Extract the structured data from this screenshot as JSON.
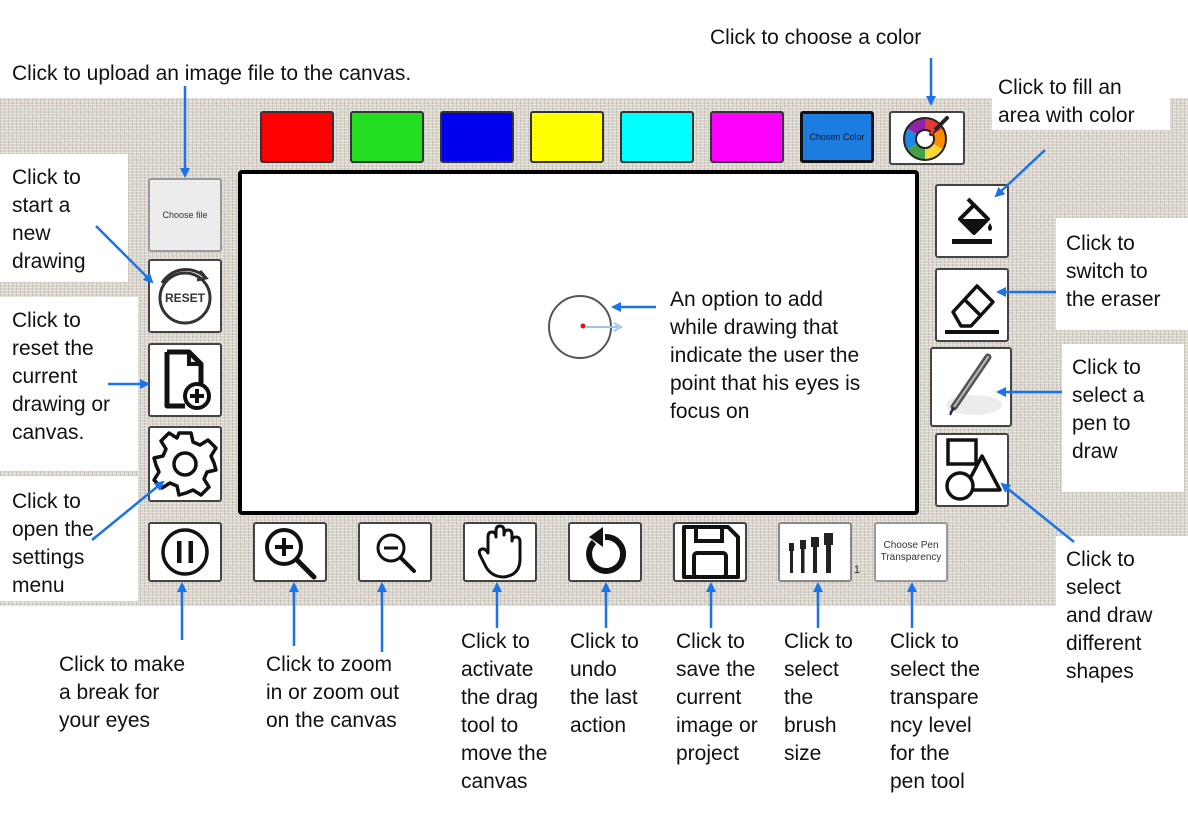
{
  "toolbar": {
    "swatch_colors": [
      "#ff0000",
      "#22dd22",
      "#0000ee",
      "#ffff00",
      "#00ffff",
      "#ff00ff"
    ],
    "chosen_color_label": "Chosen Color",
    "chosen_color_value": "#1c7ce0",
    "palette_icon": "color-palette-icon"
  },
  "left_tools": {
    "choose_file_label": "Choose file",
    "reset_label": "RESET"
  },
  "bottom_tools": {
    "brush_size_value": "1",
    "transparency_label": "Choose Pen Transparency"
  },
  "annotations": {
    "choose_color": "Click to choose a color",
    "upload_image": "Click to upload an image file to the canvas.",
    "fill_area": [
      "Click to fill an",
      "area with color"
    ],
    "start_new": [
      "Click to",
      "start a",
      "new",
      "drawing"
    ],
    "reset_current": [
      "Click to",
      "reset the",
      "current",
      "drawing or",
      "canvas."
    ],
    "open_settings": [
      "Click to",
      "open the",
      "settings",
      "menu"
    ],
    "eraser": [
      "Click to",
      "switch to",
      "the eraser"
    ],
    "pen": [
      "Click to",
      "select a",
      "pen to",
      "draw"
    ],
    "shapes": [
      "Click to",
      "select",
      "and draw",
      "different",
      "shapes"
    ],
    "focus_point": [
      "An option to add",
      "while drawing that",
      "indicate the user the",
      "point that his eyes is",
      "focus on"
    ],
    "break": [
      "Click to make",
      "a break for",
      "your eyes"
    ],
    "zoom": [
      "Click to zoom",
      "in or zoom out",
      "on the canvas"
    ],
    "drag": [
      "Click to",
      "activate",
      "the drag",
      "tool to",
      "move the",
      "canvas"
    ],
    "undo": [
      "Click to",
      "undo",
      "the last",
      "action"
    ],
    "save": [
      "Click to",
      "save the",
      "current",
      "image or",
      "project"
    ],
    "brush_size": [
      "Click to",
      "select",
      "the",
      "brush",
      "size"
    ],
    "transparency": [
      "Click to",
      "select the",
      "transpare",
      "ncy level",
      "for the",
      "pen tool"
    ]
  },
  "colors": {
    "arrow": "#1a73e8",
    "focus_dot": "#e11111"
  }
}
